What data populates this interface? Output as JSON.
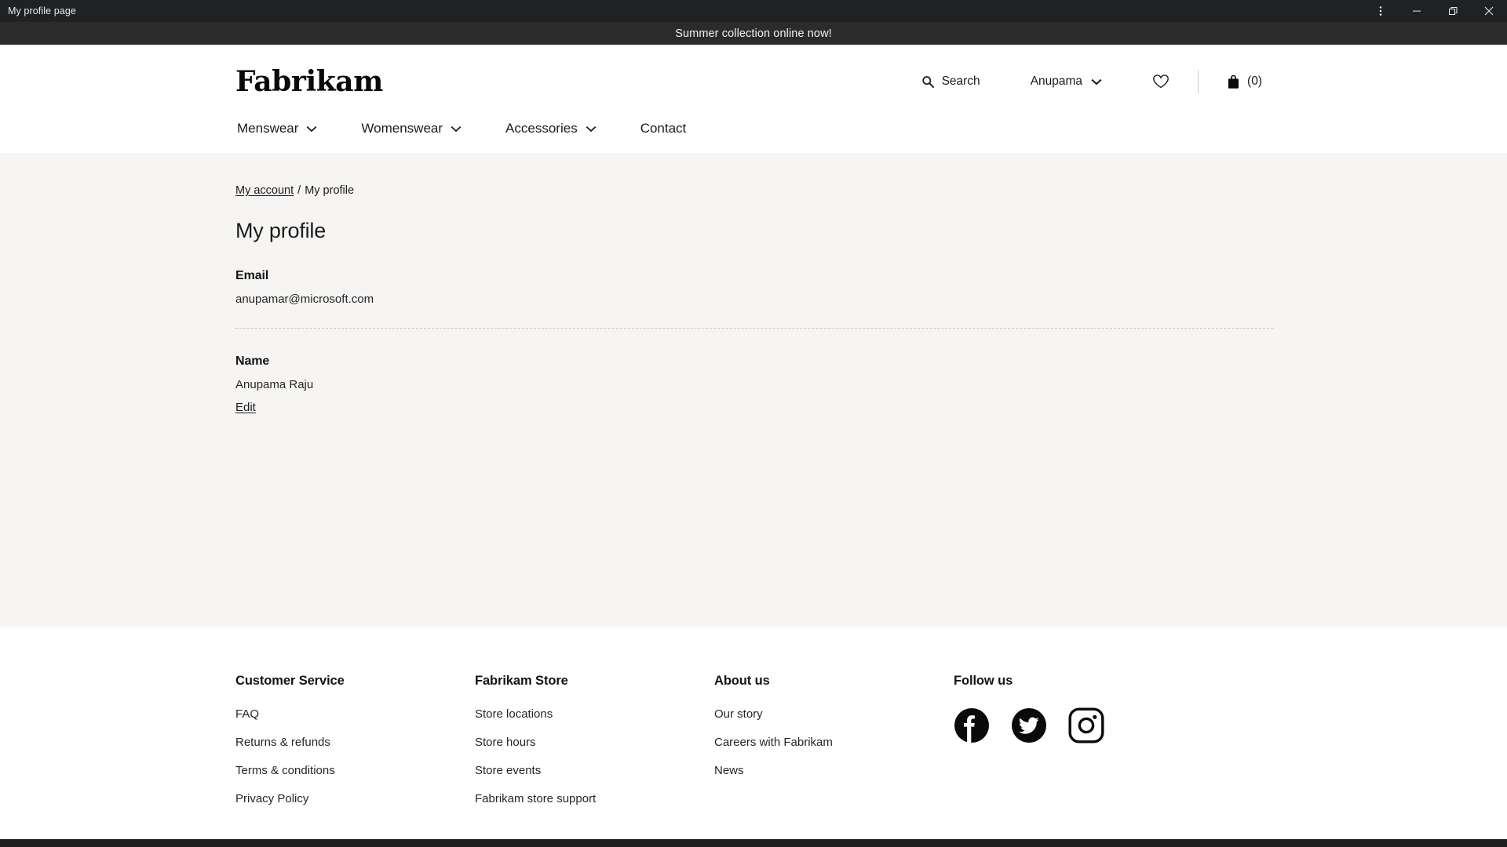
{
  "window": {
    "title": "My profile page",
    "controls": [
      {
        "name": "more-options-icon",
        "glyph": "⋮"
      },
      {
        "name": "minimize-icon",
        "glyph": "−"
      },
      {
        "name": "restore-icon",
        "glyph": "❐"
      },
      {
        "name": "close-icon",
        "glyph": "✕"
      }
    ]
  },
  "promo": {
    "text": "Summer collection online now!"
  },
  "header": {
    "brand": "Fabrikam",
    "utils": {
      "search_label": "Search",
      "account_label": "Anupama",
      "wishlist_icon": "heart-icon",
      "cart_icon": "bag-icon",
      "cart_count": "(0)"
    },
    "nav": [
      {
        "label": "Menswear",
        "has_caret": true
      },
      {
        "label": "Womenswear",
        "has_caret": true
      },
      {
        "label": "Accessories",
        "has_caret": true
      },
      {
        "label": "Contact",
        "has_caret": false
      }
    ]
  },
  "main": {
    "breadcrumb": {
      "parent": "My account",
      "separator": "/",
      "current": "My profile"
    },
    "page_title": "My profile",
    "fields": [
      {
        "label": "Email",
        "value": "anupamar@microsoft.com"
      },
      {
        "label": "Name",
        "value": "Anupama Raju",
        "action": "Edit"
      }
    ]
  },
  "footer": {
    "columns": [
      {
        "heading": "Customer Service",
        "links": [
          "FAQ",
          "Returns & refunds",
          "Terms & conditions",
          "Privacy Policy"
        ]
      },
      {
        "heading": "Fabrikam Store",
        "links": [
          "Store locations",
          "Store hours",
          "Store events",
          "Fabrikam store support"
        ]
      },
      {
        "heading": "About us",
        "links": [
          "Our story",
          "Careers with Fabrikam",
          "News"
        ]
      }
    ],
    "follow": {
      "heading": "Follow us",
      "socials": [
        "facebook-icon",
        "twitter-icon",
        "instagram-icon"
      ]
    }
  },
  "colors": {
    "titlebar_bg": "#202124",
    "promo_bg": "#2b2b2b",
    "content_bg": "#f6f5f3",
    "text": "#1b1b1b",
    "bottom_bar": "#1f1f1f"
  }
}
